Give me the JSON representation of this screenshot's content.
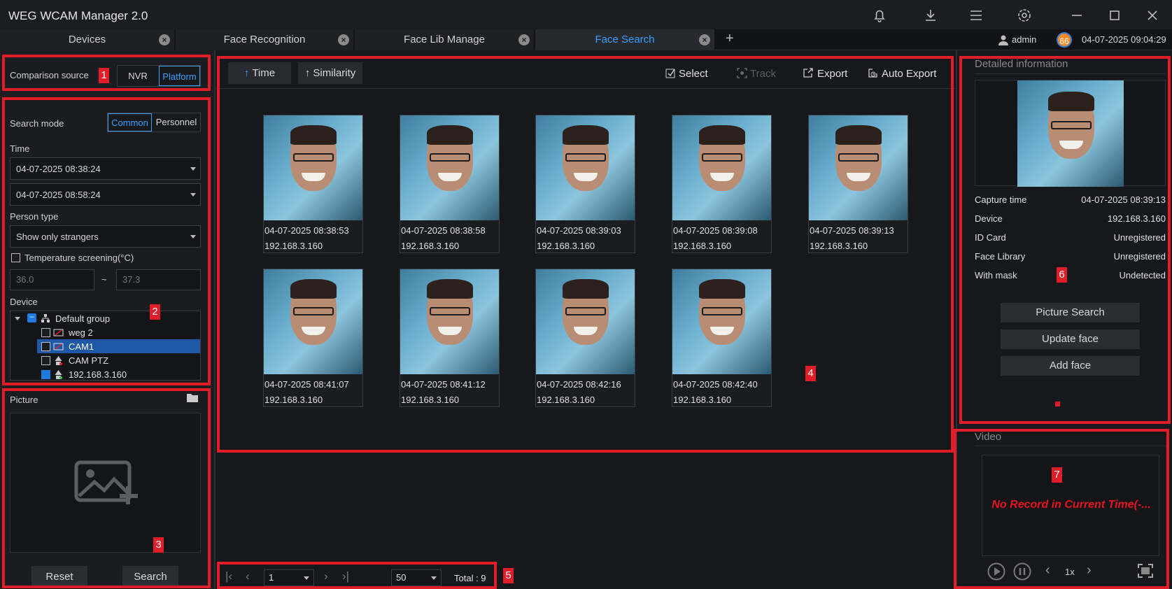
{
  "app": {
    "title": "WEG WCAM Manager 2.0"
  },
  "tabs": [
    {
      "label": "Devices"
    },
    {
      "label": "Face Recognition"
    },
    {
      "label": "Face Lib Manage"
    },
    {
      "label": "Face Search"
    }
  ],
  "add_tab": "+",
  "header": {
    "user": "admin",
    "badge": "66",
    "datetime": "04-07-2025 09:04:29"
  },
  "left": {
    "comparison_label": "Comparison source",
    "nvr": "NVR",
    "platform": "Platform",
    "search_mode_label": "Search mode",
    "common": "Common",
    "personnel": "Personnel",
    "time_label": "Time",
    "time_start": "04-07-2025 08:38:24",
    "time_end": "04-07-2025 08:58:24",
    "person_type_label": "Person type",
    "person_type_value": "Show only strangers",
    "temp_label": "Temperature screening(°C)",
    "temp_min": "36.0",
    "temp_sep": "~",
    "temp_max": "37.3",
    "device_label": "Device",
    "tree": {
      "group": "Default group",
      "items": [
        "weg 2",
        "CAM1",
        "CAM PTZ",
        "192.168.3.160"
      ]
    },
    "picture_label": "Picture",
    "reset": "Reset",
    "search": "Search"
  },
  "toolbar": {
    "time": "Time",
    "similarity": "Similarity",
    "select": "Select",
    "track": "Track",
    "export": "Export",
    "auto_export": "Auto Export"
  },
  "results": [
    {
      "time": "04-07-2025 08:38:53",
      "device": "192.168.3.160"
    },
    {
      "time": "04-07-2025 08:38:58",
      "device": "192.168.3.160"
    },
    {
      "time": "04-07-2025 08:39:03",
      "device": "192.168.3.160"
    },
    {
      "time": "04-07-2025 08:39:08",
      "device": "192.168.3.160"
    },
    {
      "time": "04-07-2025 08:39:13",
      "device": "192.168.3.160"
    },
    {
      "time": "04-07-2025 08:41:07",
      "device": "192.168.3.160"
    },
    {
      "time": "04-07-2025 08:41:12",
      "device": "192.168.3.160"
    },
    {
      "time": "04-07-2025 08:42:16",
      "device": "192.168.3.160"
    },
    {
      "time": "04-07-2025 08:42:40",
      "device": "192.168.3.160"
    }
  ],
  "pager": {
    "page": "1",
    "page_size": "50",
    "total": "Total : 9"
  },
  "detail": {
    "title": "Detailed information",
    "rows": [
      {
        "label": "Capture time",
        "value": "04-07-2025 08:39:13"
      },
      {
        "label": "Device",
        "value": "192.168.3.160"
      },
      {
        "label": "ID Card",
        "value": "Unregistered"
      },
      {
        "label": "Face Library",
        "value": "Unregistered"
      },
      {
        "label": "With mask",
        "value": "Undetected"
      }
    ],
    "picture_search": "Picture Search",
    "update_face": "Update face",
    "add_face": "Add face"
  },
  "video": {
    "title": "Video",
    "message": "No Record in Current Time(-...",
    "speed": "1x"
  },
  "annotations": [
    "1",
    "2",
    "3",
    "4",
    "5",
    "6",
    "7"
  ],
  "colors": {
    "accent": "#3aa0ff",
    "annotation": "#e21d2a",
    "error": "#e8141e"
  }
}
